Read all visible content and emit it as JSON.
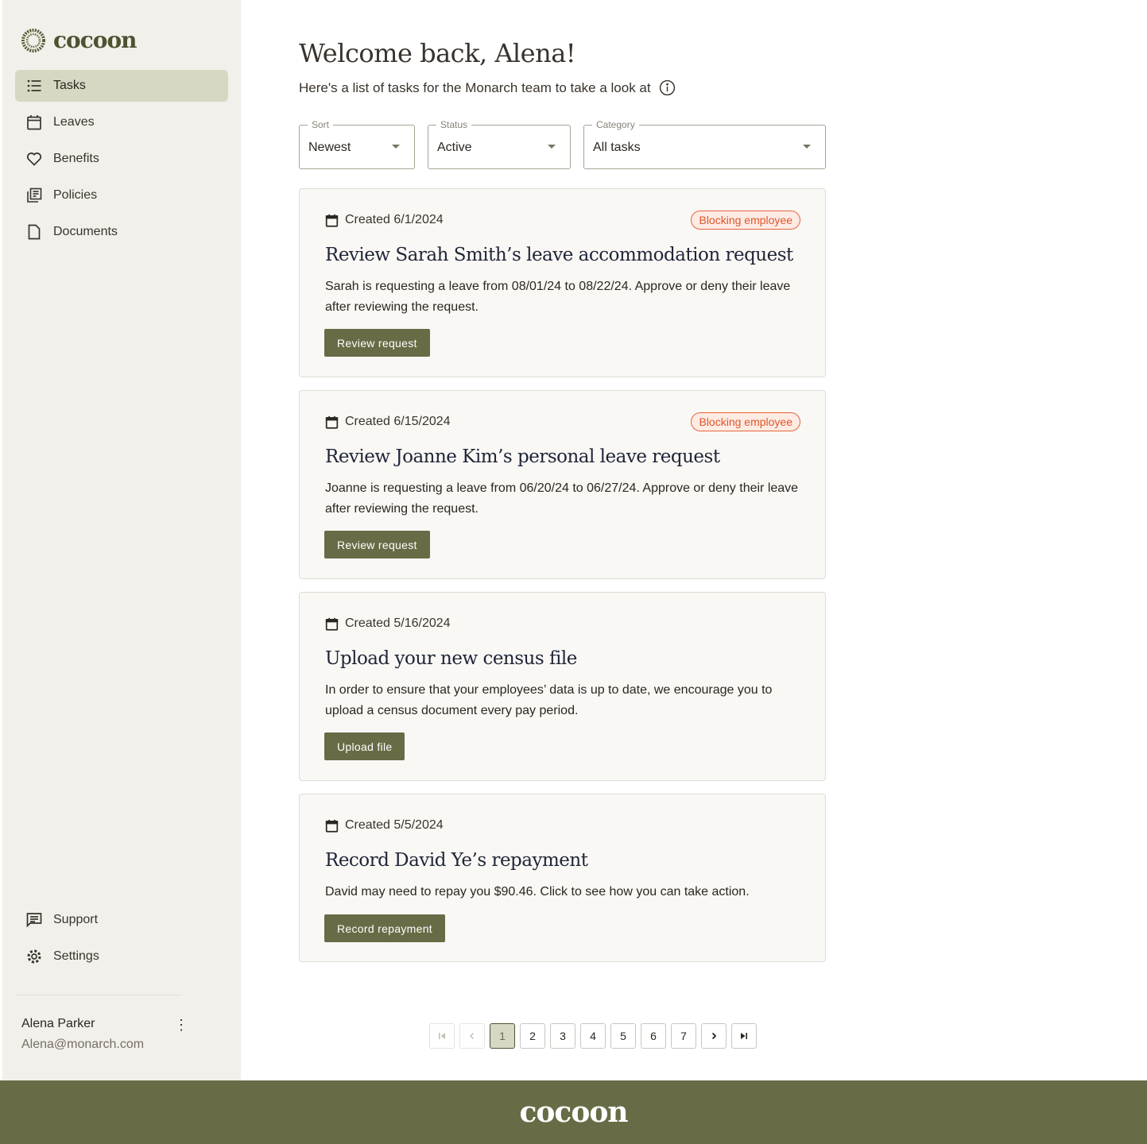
{
  "brand": {
    "name": "cocoon",
    "accent": "#686c46",
    "badge_color": "#e2552a"
  },
  "sidebar": {
    "items": [
      {
        "label": "Tasks",
        "icon": "list-icon",
        "active": true
      },
      {
        "label": "Leaves",
        "icon": "calendar-icon"
      },
      {
        "label": "Benefits",
        "icon": "heart-icon"
      },
      {
        "label": "Policies",
        "icon": "policies-icon"
      },
      {
        "label": "Documents",
        "icon": "document-icon"
      }
    ],
    "bottom": [
      {
        "label": "Support",
        "icon": "chat-icon"
      },
      {
        "label": "Settings",
        "icon": "gear-icon"
      }
    ],
    "user": {
      "name": "Alena Parker",
      "email": "Alena@monarch.com"
    }
  },
  "header": {
    "title": "Welcome back, Alena!",
    "subtitle": "Here's a list of tasks for the Monarch team to take a look at"
  },
  "filters": {
    "sort": {
      "label": "Sort",
      "value": "Newest"
    },
    "status": {
      "label": "Status",
      "value": "Active"
    },
    "category": {
      "label": "Category",
      "value": "All tasks"
    }
  },
  "tasks": [
    {
      "created": "Created 6/1/2024",
      "badge": "Blocking employee",
      "title": "Review Sarah Smith’s leave accommodation request",
      "description": "Sarah is requesting a leave from 08/01/24 to 08/22/24. Approve or deny their leave after reviewing the request.",
      "action": "Review request"
    },
    {
      "created": "Created 6/15/2024",
      "badge": "Blocking employee",
      "title": "Review Joanne Kim’s personal leave request",
      "description": "Joanne is requesting a leave from 06/20/24 to 06/27/24. Approve or deny their leave after reviewing the request.",
      "action": "Review request"
    },
    {
      "created": "Created 5/16/2024",
      "title": "Upload your new census file",
      "description": "In order to ensure that your employees’ data is up to date, we encourage you to upload a census document every pay period.",
      "action": "Upload file"
    },
    {
      "created": "Created 5/5/2024",
      "title": "Record David Ye’s repayment",
      "description": "David may need to repay you $90.46. Click to see how you can take action.",
      "action": "Record repayment"
    }
  ],
  "pagination": {
    "current": 1,
    "pages": [
      "1",
      "2",
      "3",
      "4",
      "5",
      "6",
      "7"
    ]
  },
  "footer": {
    "brand": "cocoon"
  }
}
